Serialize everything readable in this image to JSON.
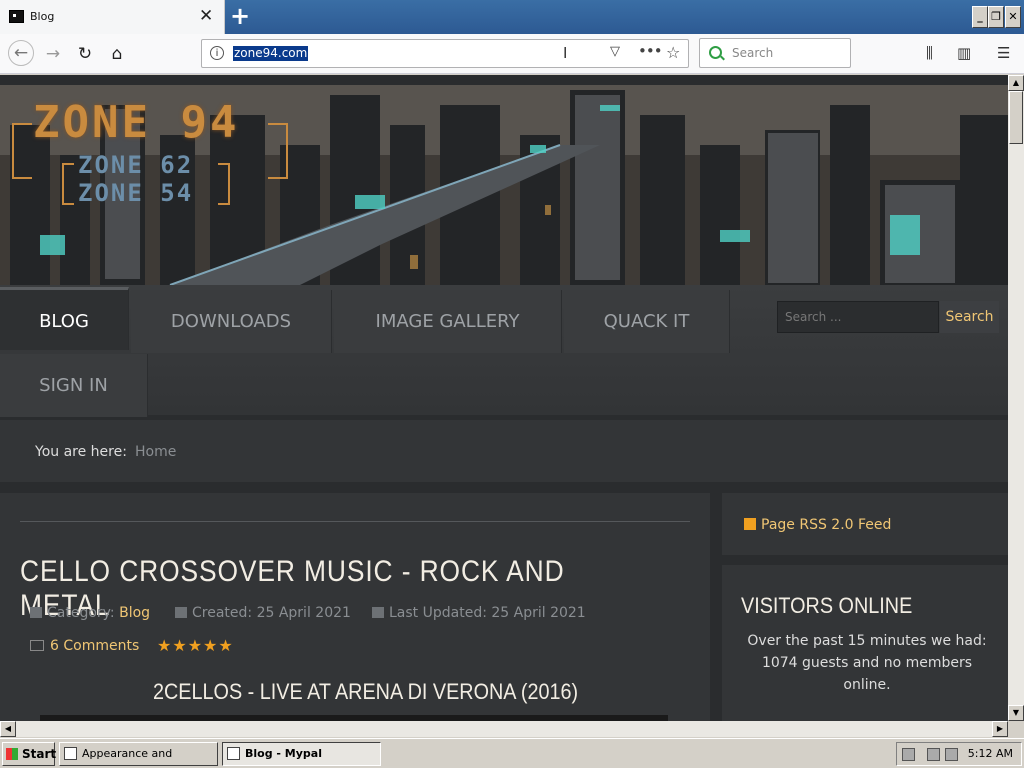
{
  "browser": {
    "tab_title": "Blog",
    "new_tab_symbol": "+",
    "url": "zone94.com",
    "search_placeholder": "Search"
  },
  "site": {
    "logo": "ZONE 94",
    "logo_sub1": "ZONE 62",
    "logo_sub2": "ZONE 54",
    "menu": [
      {
        "label": "BLOG"
      },
      {
        "label": "DOWNLOADS"
      },
      {
        "label": "IMAGE GALLERY"
      },
      {
        "label": "QUACK IT"
      },
      {
        "label": "SIGN IN"
      }
    ],
    "search_placeholder": "Search ...",
    "search_button": "Search",
    "breadcrumb_label": "You are here:",
    "breadcrumb_home": "Home"
  },
  "article": {
    "title": "CELLO CROSSOVER MUSIC - ROCK AND METAL",
    "category_label": "Category:",
    "category": "Blog",
    "created": "Created: 25 April 2021",
    "updated": "Last Updated: 25 April 2021",
    "comments": "6 Comments",
    "stars": "★★★★★",
    "subtitle": "2CELLOS - LIVE AT ARENA DI VERONA (2016)"
  },
  "sidebar": {
    "rss": "Page RSS 2.0 Feed",
    "visitors_title": "VISITORS ONLINE",
    "visitors_text": "Over the past 15 minutes we had: 1074 guests and no members online."
  },
  "taskbar": {
    "start": "Start",
    "task1": "Appearance and Themes",
    "task2": "Blog - Mypal",
    "clock": "5:12 AM"
  }
}
